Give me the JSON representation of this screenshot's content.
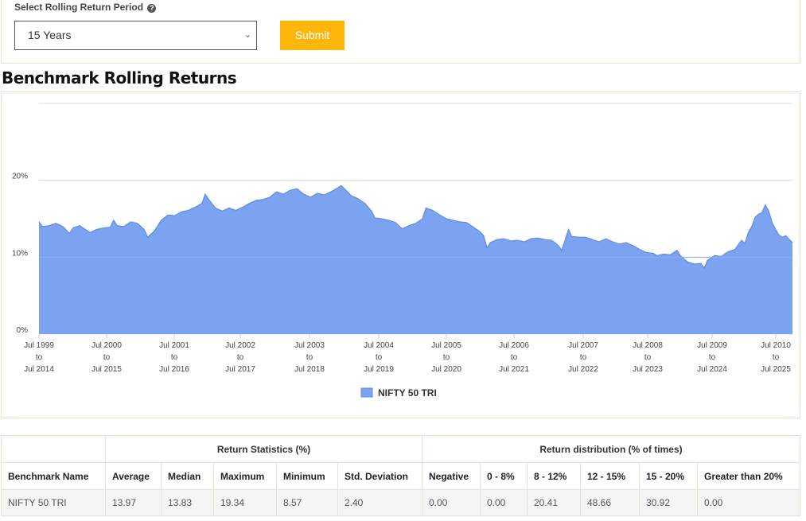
{
  "form": {
    "label": "Select Rolling Return Period",
    "help_icon": "question-circle-icon",
    "selected_period": "15 Years",
    "submit_label": "Submit",
    "accent_color": "#ffb60a"
  },
  "section_title": "Benchmark Rolling Returns",
  "chart_data": {
    "type": "area",
    "title": "",
    "xlabel": "",
    "ylabel": "",
    "ylim": [
      0,
      30
    ],
    "y_ticks": [
      "0%",
      "10%",
      "20%"
    ],
    "grid": true,
    "legend_position": "bottom-center",
    "series_color": "#7ba3ef",
    "x_tick_labels": [
      [
        "Jul 1999",
        "to",
        "Jul 2014"
      ],
      [
        "Jul 2000",
        "to",
        "Jul 2015"
      ],
      [
        "Jul 2001",
        "to",
        "Jul 2016"
      ],
      [
        "Jul 2002",
        "to",
        "Jul 2017"
      ],
      [
        "Jul 2003",
        "to",
        "Jul 2018"
      ],
      [
        "Jul 2004",
        "to",
        "Jul 2019"
      ],
      [
        "Jul 2005",
        "to",
        "Jul 2020"
      ],
      [
        "Jul 2006",
        "to",
        "Jul 2021"
      ],
      [
        "Jul 2007",
        "to",
        "Jul 2022"
      ],
      [
        "Jul 2008",
        "to",
        "Jul 2023"
      ],
      [
        "Jul 2009",
        "to",
        "Jul 2024"
      ],
      [
        "Jul 2010",
        "to",
        "Jul 2025"
      ]
    ],
    "series": [
      {
        "name": "NIFTY 50 TRI",
        "x_start_year": 1999.5,
        "x_end_year": 2010.6,
        "values": [
          [
            1999.5,
            14.6
          ],
          [
            1999.55,
            14.0
          ],
          [
            1999.65,
            14.1
          ],
          [
            1999.75,
            14.4
          ],
          [
            1999.85,
            14.0
          ],
          [
            1999.95,
            13.1
          ],
          [
            2000.0,
            13.8
          ],
          [
            2000.1,
            14.1
          ],
          [
            2000.25,
            13.2
          ],
          [
            2000.35,
            13.6
          ],
          [
            2000.45,
            13.8
          ],
          [
            2000.55,
            13.9
          ],
          [
            2000.6,
            14.8
          ],
          [
            2000.65,
            14.1
          ],
          [
            2000.75,
            14.0
          ],
          [
            2000.85,
            14.6
          ],
          [
            2000.95,
            14.4
          ],
          [
            2001.05,
            13.6
          ],
          [
            2001.1,
            12.6
          ],
          [
            2001.2,
            13.4
          ],
          [
            2001.3,
            14.8
          ],
          [
            2001.4,
            15.5
          ],
          [
            2001.5,
            15.4
          ],
          [
            2001.6,
            15.9
          ],
          [
            2001.7,
            16.1
          ],
          [
            2001.8,
            16.5
          ],
          [
            2001.9,
            17.0
          ],
          [
            2001.95,
            18.2
          ],
          [
            2002.0,
            17.5
          ],
          [
            2002.1,
            16.4
          ],
          [
            2002.2,
            16.0
          ],
          [
            2002.3,
            16.4
          ],
          [
            2002.4,
            16.1
          ],
          [
            2002.5,
            16.5
          ],
          [
            2002.6,
            17.0
          ],
          [
            2002.7,
            17.4
          ],
          [
            2002.8,
            17.5
          ],
          [
            2002.9,
            17.8
          ],
          [
            2003.0,
            18.5
          ],
          [
            2003.1,
            18.2
          ],
          [
            2003.2,
            18.7
          ],
          [
            2003.3,
            18.9
          ],
          [
            2003.4,
            18.2
          ],
          [
            2003.5,
            17.8
          ],
          [
            2003.6,
            18.3
          ],
          [
            2003.7,
            18.1
          ],
          [
            2003.8,
            18.5
          ],
          [
            2003.9,
            19.0
          ],
          [
            2003.95,
            19.3
          ],
          [
            2004.0,
            18.9
          ],
          [
            2004.1,
            18.0
          ],
          [
            2004.2,
            17.6
          ],
          [
            2004.3,
            17.0
          ],
          [
            2004.4,
            16.0
          ],
          [
            2004.45,
            15.1
          ],
          [
            2004.55,
            15.0
          ],
          [
            2004.65,
            14.8
          ],
          [
            2004.75,
            14.5
          ],
          [
            2004.85,
            13.7
          ],
          [
            2004.95,
            14.1
          ],
          [
            2005.05,
            14.4
          ],
          [
            2005.15,
            15.0
          ],
          [
            2005.2,
            16.4
          ],
          [
            2005.3,
            16.1
          ],
          [
            2005.4,
            15.5
          ],
          [
            2005.5,
            15.0
          ],
          [
            2005.6,
            14.8
          ],
          [
            2005.7,
            14.6
          ],
          [
            2005.8,
            14.5
          ],
          [
            2005.9,
            13.9
          ],
          [
            2006.0,
            13.3
          ],
          [
            2006.05,
            12.8
          ],
          [
            2006.1,
            11.2
          ],
          [
            2006.15,
            11.9
          ],
          [
            2006.25,
            12.3
          ],
          [
            2006.35,
            12.4
          ],
          [
            2006.45,
            12.1
          ],
          [
            2006.55,
            12.2
          ],
          [
            2006.65,
            12.0
          ],
          [
            2006.75,
            12.4
          ],
          [
            2006.85,
            12.5
          ],
          [
            2006.95,
            12.3
          ],
          [
            2007.05,
            12.2
          ],
          [
            2007.1,
            11.9
          ],
          [
            2007.15,
            11.5
          ],
          [
            2007.2,
            10.9
          ],
          [
            2007.25,
            12.2
          ],
          [
            2007.3,
            13.6
          ],
          [
            2007.35,
            12.7
          ],
          [
            2007.45,
            12.6
          ],
          [
            2007.55,
            12.6
          ],
          [
            2007.65,
            12.3
          ],
          [
            2007.75,
            12.0
          ],
          [
            2007.85,
            12.4
          ],
          [
            2007.95,
            12.0
          ],
          [
            2008.05,
            11.7
          ],
          [
            2008.15,
            11.9
          ],
          [
            2008.25,
            11.5
          ],
          [
            2008.35,
            11.0
          ],
          [
            2008.45,
            10.6
          ],
          [
            2008.55,
            10.5
          ],
          [
            2008.6,
            10.2
          ],
          [
            2008.7,
            10.4
          ],
          [
            2008.8,
            10.3
          ],
          [
            2008.9,
            10.9
          ],
          [
            2008.95,
            10.2
          ],
          [
            2009.05,
            9.4
          ],
          [
            2009.15,
            9.1
          ],
          [
            2009.25,
            9.2
          ],
          [
            2009.3,
            8.6
          ],
          [
            2009.35,
            9.6
          ],
          [
            2009.45,
            10.2
          ],
          [
            2009.55,
            10.1
          ],
          [
            2009.65,
            10.7
          ],
          [
            2009.75,
            11.0
          ],
          [
            2009.85,
            12.2
          ],
          [
            2009.9,
            11.8
          ],
          [
            2009.95,
            13.2
          ],
          [
            2010.0,
            14.0
          ],
          [
            2010.05,
            15.2
          ],
          [
            2010.1,
            15.6
          ],
          [
            2010.15,
            15.8
          ],
          [
            2010.2,
            16.8
          ],
          [
            2010.25,
            16.0
          ],
          [
            2010.3,
            14.5
          ],
          [
            2010.35,
            13.6
          ],
          [
            2010.4,
            12.9
          ],
          [
            2010.45,
            12.6
          ],
          [
            2010.5,
            12.8
          ],
          [
            2010.6,
            11.9
          ]
        ]
      }
    ]
  },
  "table": {
    "group_headers": {
      "statistics": "Return Statistics (%)",
      "distribution": "Return distribution (% of times)"
    },
    "columns": [
      "Benchmark Name",
      "Average",
      "Median",
      "Maximum",
      "Minimum",
      "Std. Deviation",
      "Negative",
      "0 - 8%",
      "8 - 12%",
      "12 - 15%",
      "15 - 20%",
      "Greater than 20%"
    ],
    "rows": [
      [
        "NIFTY 50 TRI",
        "13.97",
        "13.83",
        "19.34",
        "8.57",
        "2.40",
        "0.00",
        "0.00",
        "20.41",
        "48.66",
        "30.92",
        "0.00"
      ]
    ]
  }
}
